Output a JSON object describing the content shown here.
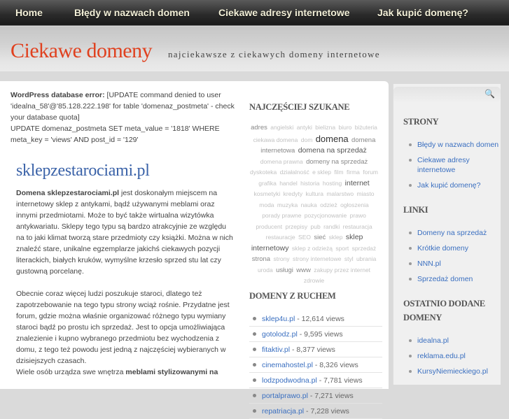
{
  "nav": [
    "Home",
    "Błędy w nazwach domen",
    "Ciekawe adresy internetowe",
    "Jak kupić domenę?"
  ],
  "header": {
    "title": "Ciekawe domeny",
    "tagline": "najciekawsze z ciekawych domeny internetowe"
  },
  "error": {
    "label": "WordPress database error:",
    "message": "[UPDATE command denied to user 'idealna_58'@'85.128.222.198' for table 'domenaz_postmeta' - check your database quota]",
    "query": "UPDATE domenaz_postmeta SET meta_value = '1818' WHERE meta_key = 'views' AND post_id = '129'"
  },
  "post": {
    "title": "sklepzestarociami.pl",
    "p1_bold": "Domena sklepzestarociami.pl",
    "p1": " jest doskonałym miejscem na internetowy sklep z antykami, bądź używanymi meblami oraz innymi przedmiotami. Może to być także wirtualna wizytówka antykwariatu. Sklepy tego typu są bardzo atrakcyjnie ze względu na to jaki klimat tworzą stare przedmioty czy książki. Można w nich znaleźć stare, unikalne egzemplarze jakichś ciekawych pozycji literackich, białych kruków, wymyślne krzesło sprzed stu lat czy gustowną porcelanę.",
    "p2": "Obecnie coraz więcej ludzi poszukuje staroci, dlatego też zapotrzebowanie na tego typu strony wciąż rośnie. Przydatne jest forum, gdzie można właśnie organizować różnego typu wymiany staroci bądź po prostu ich sprzedaż. Jest to opcja umożliwiająca znalezienie i kupno wybranego przedmiotu bez wychodzenia z domu, z tego też powodu jest jedną z najczęściej wybieranych w dzisiejszych czasach.",
    "p3": "Wiele osób urządza swe wnętrza ",
    "p3_bold": "meblami stylizowanymi na"
  },
  "cloud": {
    "title": "NAJCZĘŚCIEJ SZUKANE",
    "tags": [
      {
        "t": "adres",
        "w": 2
      },
      {
        "t": "angielski",
        "w": 1
      },
      {
        "t": "antyki",
        "w": 1
      },
      {
        "t": "bielizna",
        "w": 1
      },
      {
        "t": "biuro",
        "w": 1
      },
      {
        "t": "biżuteria",
        "w": 1
      },
      {
        "t": "ciekawa domena",
        "w": 1
      },
      {
        "t": "dom",
        "w": 1
      },
      {
        "t": "domena",
        "w": 4
      },
      {
        "t": "domena internetowa",
        "w": 2
      },
      {
        "t": "domena na sprzedaż",
        "w": 3
      },
      {
        "t": "domena prawna",
        "w": 1
      },
      {
        "t": "domeny na sprzedaż",
        "w": 2
      },
      {
        "t": "dyskoteka",
        "w": 1
      },
      {
        "t": "działalność",
        "w": 1
      },
      {
        "t": "e sklep",
        "w": 1
      },
      {
        "t": "film",
        "w": 1
      },
      {
        "t": "firma",
        "w": 1
      },
      {
        "t": "forum",
        "w": 1
      },
      {
        "t": "grafika",
        "w": 1
      },
      {
        "t": "handel",
        "w": 1
      },
      {
        "t": "historia",
        "w": 1
      },
      {
        "t": "hosting",
        "w": 1
      },
      {
        "t": "internet",
        "w": 3
      },
      {
        "t": "kosmetyki",
        "w": 1
      },
      {
        "t": "kredyty",
        "w": 1
      },
      {
        "t": "kultura",
        "w": 1
      },
      {
        "t": "malarstwo",
        "w": 1
      },
      {
        "t": "miasto",
        "w": 1
      },
      {
        "t": "moda",
        "w": 1
      },
      {
        "t": "muzyka",
        "w": 1
      },
      {
        "t": "nauka",
        "w": 1
      },
      {
        "t": "odzież",
        "w": 1
      },
      {
        "t": "ogłoszenia",
        "w": 1
      },
      {
        "t": "porady prawne",
        "w": 1
      },
      {
        "t": "pozycjonowanie",
        "w": 1
      },
      {
        "t": "prawo",
        "w": 1
      },
      {
        "t": "producent",
        "w": 1
      },
      {
        "t": "przepisy",
        "w": 1
      },
      {
        "t": "pub",
        "w": 1
      },
      {
        "t": "randki",
        "w": 1
      },
      {
        "t": "restauracja",
        "w": 1
      },
      {
        "t": "restauracje",
        "w": 1
      },
      {
        "t": "SEO",
        "w": 1
      },
      {
        "t": "sieć",
        "w": 2
      },
      {
        "t": "sklep",
        "w": 1
      },
      {
        "t": "sklep internetowy",
        "w": 3
      },
      {
        "t": "sklep z odzieżą",
        "w": 1
      },
      {
        "t": "sport",
        "w": 1
      },
      {
        "t": "sprzedaż",
        "w": 1
      },
      {
        "t": "strona",
        "w": 2
      },
      {
        "t": "strony",
        "w": 1
      },
      {
        "t": "strony internetowe",
        "w": 1
      },
      {
        "t": "styl",
        "w": 1
      },
      {
        "t": "ubrania",
        "w": 1
      },
      {
        "t": "uroda",
        "w": 1
      },
      {
        "t": "usługi",
        "w": 2
      },
      {
        "t": "www",
        "w": 2
      },
      {
        "t": "zakupy przez internet",
        "w": 1
      },
      {
        "t": "zdrowie",
        "w": 1
      }
    ]
  },
  "popular": {
    "title": "DOMENY Z RUCHEM",
    "items": [
      {
        "name": "sklep4u.pl",
        "views": " - 12,614 views"
      },
      {
        "name": "gotolodz.pl",
        "views": " - 9,595 views"
      },
      {
        "name": "fitaktiv.pl",
        "views": " - 8,377 views"
      },
      {
        "name": "cinemahostel.pl",
        "views": " - 8,326 views"
      },
      {
        "name": "lodzpodwodna.pl",
        "views": " - 7,781 views"
      },
      {
        "name": "portalprawo.pl",
        "views": " - 7,271 views"
      },
      {
        "name": "repatriacja.pl",
        "views": " - 7,228 views"
      }
    ]
  },
  "sidebar": {
    "strony": {
      "title": "STRONY",
      "items": [
        "Błędy w nazwach domen",
        "Ciekawe adresy internetowe",
        "Jak kupić domenę?"
      ]
    },
    "linki": {
      "title": "LINKI",
      "items": [
        "Domeny na sprzedaż",
        "Krótkie domeny",
        "NNN.pl",
        "Sprzedaż domen"
      ]
    },
    "recent": {
      "title": "OSTATNIO DODANE DOMENY",
      "items": [
        "idealna.pl",
        "reklama.edu.pl",
        "KursyNiemieckiego.pl"
      ]
    }
  }
}
